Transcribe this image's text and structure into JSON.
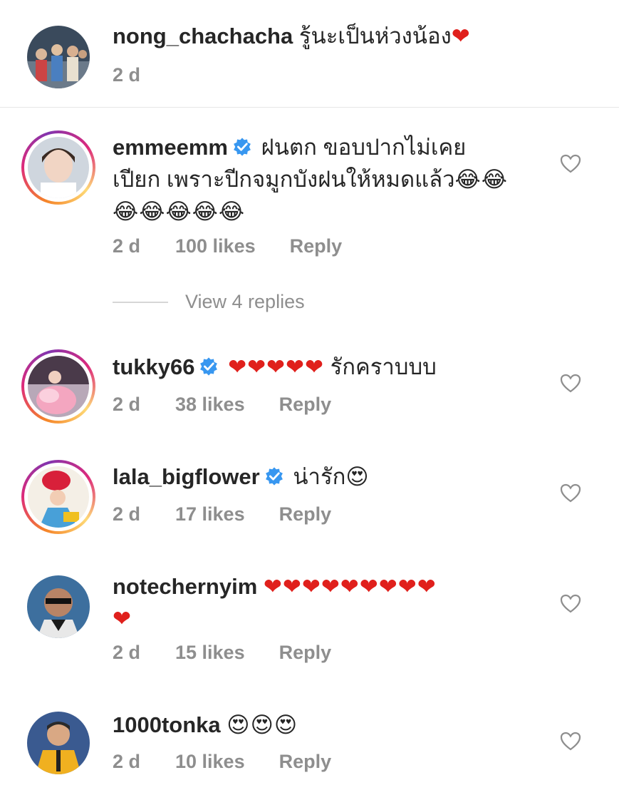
{
  "comments": [
    {
      "username": "nong_chachacha",
      "text": "รู้นะเป็นห่วงน้อง",
      "emoji": "❤",
      "time": "2 d",
      "verified": false
    },
    {
      "username": "emmeemm",
      "text_line1": "ฝนตก ขอบปากไม่เคย",
      "text_line2": "เปียก เพราะปีกจมูกบังฝนให้หมดแล้ว",
      "emoji_line2": "😂😂",
      "emoji_line3": "😂😂😂😂😂",
      "time": "2 d",
      "likes": "100 likes",
      "reply": "Reply",
      "view_replies": "View 4 replies",
      "verified": true
    },
    {
      "username": "tukky66",
      "emoji": "❤❤❤❤❤",
      "text": "รักคราบบบ",
      "time": "2 d",
      "likes": "38 likes",
      "reply": "Reply",
      "verified": true
    },
    {
      "username": "lala_bigflower",
      "text": "น่ารัก",
      "emoji": "😍",
      "time": "2 d",
      "likes": "17 likes",
      "reply": "Reply",
      "verified": true
    },
    {
      "username": "notechernyim",
      "emoji_line1": "❤❤❤❤❤❤❤❤❤",
      "emoji_line2": "❤",
      "time": "2 d",
      "likes": "15 likes",
      "reply": "Reply",
      "verified": false
    },
    {
      "username": "1000tonka",
      "emoji": "😍😍😍",
      "time": "2 d",
      "likes": "10 likes",
      "reply": "Reply",
      "verified": false
    }
  ],
  "colors": {
    "verified_blue": "#3897f0",
    "heart_red": "#e0201c",
    "meta_gray": "#8e8e8e"
  },
  "icons": {
    "like": "heart-outline-icon",
    "verified": "verified-badge-icon"
  }
}
